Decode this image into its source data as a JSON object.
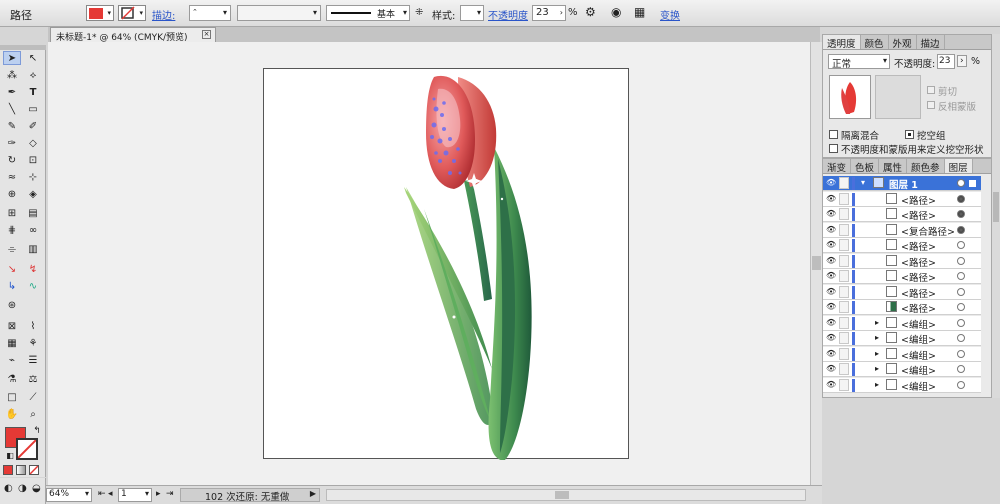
{
  "control": {
    "object_type": "路径",
    "stroke_label": "描边:",
    "stroke_profile": "基本",
    "style_label": "样式:",
    "opacity_label": "不透明度",
    "opacity_value": "23",
    "opacity_unit": "%",
    "transform_link": "变换"
  },
  "document": {
    "tab_title": "未标题-1* @ 64% (CMYK/预览)",
    "close_glyph": "×"
  },
  "status": {
    "zoom": "64%",
    "artboard_no": "1",
    "status_text": "102 次还原: 无重做"
  },
  "colors": {
    "fill": "#e53935",
    "accent": "#4a6fdc"
  },
  "transparency_panel": {
    "tabs": [
      "透明度",
      "颜色",
      "外观",
      "描边"
    ],
    "blend_mode": "正常",
    "opacity_label": "不透明度:",
    "opacity_value": "23",
    "opacity_unit": "%",
    "clip_label": "剪切",
    "invert_mask_label": "反相蒙版",
    "isolate_blending_label": "隔离混合",
    "knockout_group_label": "挖空组",
    "knockout_option_label": "不透明度和蒙版用来定义挖空形状"
  },
  "layers_panel": {
    "tabs": [
      "渐变",
      "色板",
      "属性",
      "颜色参",
      "图层"
    ],
    "rows": [
      {
        "name": "图层 1"
      },
      {
        "name": "<路径>"
      },
      {
        "name": "<路径>"
      },
      {
        "name": "<复合路径>"
      },
      {
        "name": "<路径>"
      },
      {
        "name": "<路径>"
      },
      {
        "name": "<路径>"
      },
      {
        "name": "<路径>"
      },
      {
        "name": "<路径>"
      },
      {
        "name": "<编组>"
      },
      {
        "name": "<编组>"
      },
      {
        "name": "<编组>"
      },
      {
        "name": "<编组>"
      },
      {
        "name": "<编组>"
      }
    ]
  }
}
